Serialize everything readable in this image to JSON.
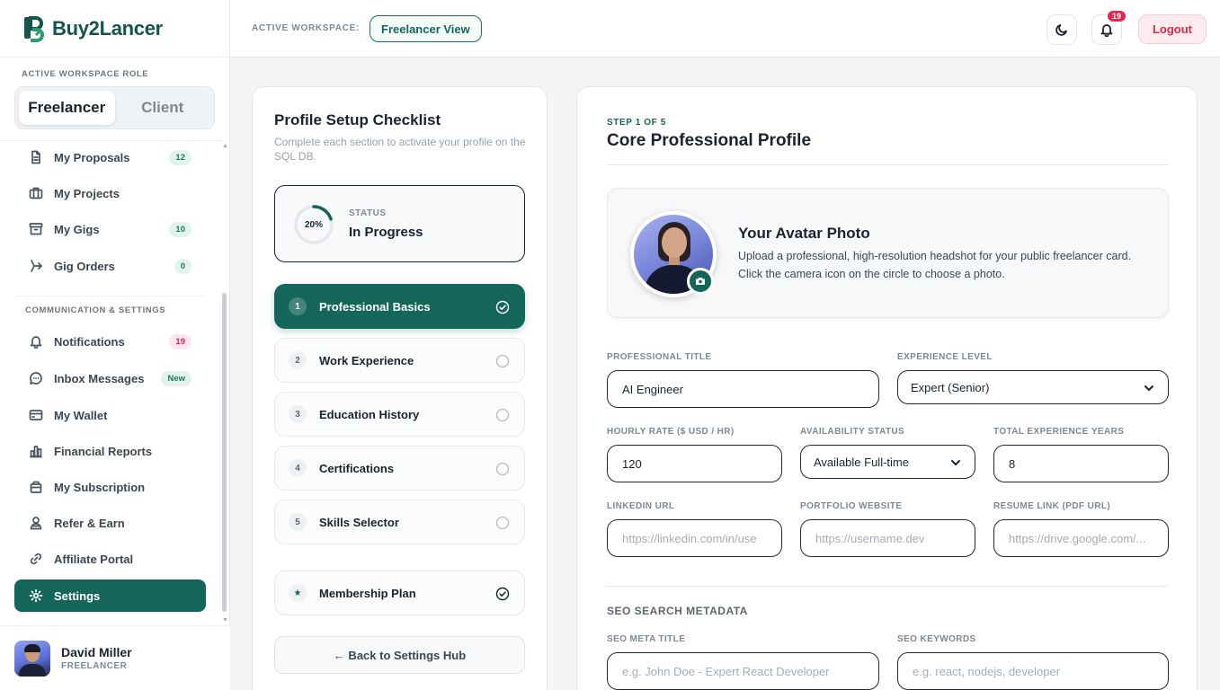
{
  "brand": {
    "name": "Buy2Lancer"
  },
  "sidebar": {
    "role_label": "ACTIVE WORKSPACE ROLE",
    "roles": [
      {
        "label": "Freelancer",
        "active": true
      },
      {
        "label": "Client",
        "active": false
      }
    ],
    "items": [
      {
        "label": "My Proposals",
        "icon": "file-icon",
        "badge": "12"
      },
      {
        "label": "My Projects",
        "icon": "briefcase-icon",
        "badge": ""
      },
      {
        "label": "My Gigs",
        "icon": "archive-icon",
        "badge": "10"
      },
      {
        "label": "Gig Orders",
        "icon": "tag-icon",
        "badge": "0"
      }
    ],
    "section_label": "COMMUNICATION & SETTINGS",
    "items2": [
      {
        "label": "Notifications",
        "icon": "bell-icon",
        "badge": "19"
      },
      {
        "label": "Inbox Messages",
        "icon": "chat-icon",
        "badge": "New"
      },
      {
        "label": "My Wallet",
        "icon": "wallet-icon",
        "badge": ""
      },
      {
        "label": "Financial Reports",
        "icon": "bar-chart-icon",
        "badge": ""
      },
      {
        "label": "My Subscription",
        "icon": "package-icon",
        "badge": ""
      },
      {
        "label": "Refer & Earn",
        "icon": "users-icon",
        "badge": ""
      },
      {
        "label": "Affiliate Portal",
        "icon": "link-icon",
        "badge": ""
      },
      {
        "label": "Settings",
        "icon": "gear-icon",
        "badge": "",
        "active": true
      }
    ],
    "user": {
      "name": "David Miller",
      "role": "FREELANCER"
    }
  },
  "header": {
    "workspace_label": "ACTIVE WORKSPACE:",
    "workspace_value": "Freelancer View",
    "notification_count": "19",
    "logout_label": "Logout"
  },
  "checklist": {
    "title": "Profile Setup Checklist",
    "subtitle": "Complete each section to activate your profile on the SQL DB.",
    "progress_percent": 20,
    "progress_label": "20%",
    "status_key": "STATUS",
    "status_value": "In Progress",
    "steps": [
      {
        "num": "1",
        "label": "Professional Basics",
        "done": true,
        "active": true
      },
      {
        "num": "2",
        "label": "Work Experience",
        "done": false
      },
      {
        "num": "3",
        "label": "Education History",
        "done": false
      },
      {
        "num": "4",
        "label": "Certifications",
        "done": false
      },
      {
        "num": "5",
        "label": "Skills Selector",
        "done": false
      }
    ],
    "membership": {
      "num": "★",
      "label": "Membership Plan",
      "done": true
    },
    "back_label": "← Back to Settings Hub"
  },
  "form": {
    "step_tag": "STEP 1 OF 5",
    "title": "Core Professional Profile",
    "avatar_title": "Your Avatar Photo",
    "avatar_desc": "Upload a professional, high-resolution headshot for your public freelancer card. Click the camera icon on the circle to choose a photo.",
    "fields": {
      "professional_title": {
        "label": "Professional Title",
        "value": "AI Engineer"
      },
      "experience_level": {
        "label": "Experience Level",
        "value": "Expert (Senior)"
      },
      "hourly_rate": {
        "label": "Hourly Rate ($ USD / HR)",
        "value": "120"
      },
      "availability": {
        "label": "Availability Status",
        "value": "Available Full-time"
      },
      "experience_years": {
        "label": "Total Experience Years",
        "value": "8"
      },
      "linkedin": {
        "label": "LinkedIn URL",
        "placeholder": "https://linkedin.com/in/use"
      },
      "portfolio": {
        "label": "Portfolio Website",
        "placeholder": "https://username.dev"
      },
      "resume": {
        "label": "Resume Link (PDF URL)",
        "placeholder": "https://drive.google.com/..."
      }
    },
    "seo_title": "SEO SEARCH METADATA",
    "seo": {
      "meta_title": {
        "label": "SEO Meta Title",
        "placeholder": "e.g. John Doe - Expert React Developer"
      },
      "keywords": {
        "label": "SEO Keywords",
        "placeholder": "e.g. react, nodejs, developer"
      }
    }
  },
  "colors": {
    "accent": "#15665a",
    "danger": "#e2284f"
  }
}
